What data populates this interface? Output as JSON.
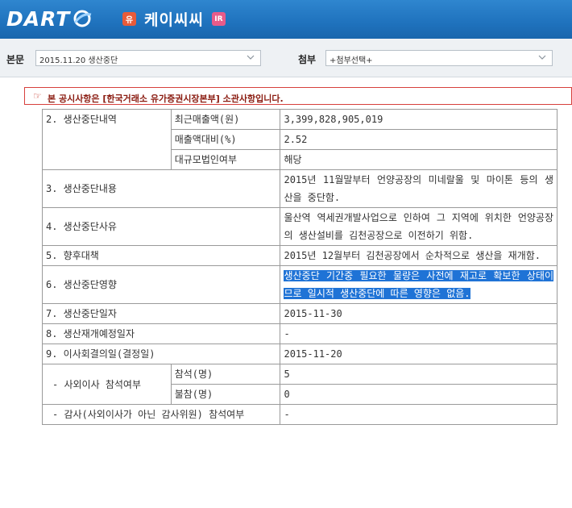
{
  "header": {
    "logo": "DART",
    "badge_left": "유",
    "company_name": "케이씨씨",
    "badge_right": "IR"
  },
  "toolbar": {
    "report_label": "본문",
    "report_value": "2015.11.20  생산중단",
    "attach_label": "첨부",
    "attach_value": "+첨부선택+"
  },
  "notice": {
    "icon": "pointing-hand-icon",
    "text": "본 공시사항은 [한국거래소 유가증권시장본부] 소관사항입니다."
  },
  "rows": {
    "r2_label": "2. 생산중단내역",
    "r2a_label": "최근매출액(원)",
    "r2a_value": "3,399,828,905,019",
    "r2b_label": "매출액대비(%)",
    "r2b_value": "2.52",
    "r2c_label": "대규모법인여부",
    "r2c_value": "해당",
    "r3_label": "3. 생산중단내용",
    "r3_value": "2015년 11월말부터 언양공장의 미네랄울 및 마이톤 등의 생산을 중단함.",
    "r4_label": "4. 생산중단사유",
    "r4_value": "울산역 역세권개발사업으로 인하여 그 지역에 위치한 언양공장의 생산설비를 김천공장으로 이전하기 위함.",
    "r5_label": "5. 향후대책",
    "r5_value": "2015년 12월부터 김천공장에서 순차적으로 생산을 재개함.",
    "r6_label": "6. 생산중단영향",
    "r6_value": "생산중단 기간중  필요한 물량은 사전에 재고로 확보한 상태이므로 일시적 생산중단에 따른 영향은 없음.",
    "r7_label": "7. 생산중단일자",
    "r7_value": "2015-11-30",
    "r8_label": "8. 생산재개예정일자",
    "r8_value": "-",
    "r9_label": "9. 이사회결의일(결정일)",
    "r9_value": "2015-11-20",
    "r10_label": "- 사외이사 참석여부",
    "r10a_label": "참석(명)",
    "r10a_value": "5",
    "r10b_label": "불참(명)",
    "r10b_value": "0",
    "r11_label": "- 감사(사외이사가 아닌 감사위원) 참석여부",
    "r11_value": "-"
  }
}
